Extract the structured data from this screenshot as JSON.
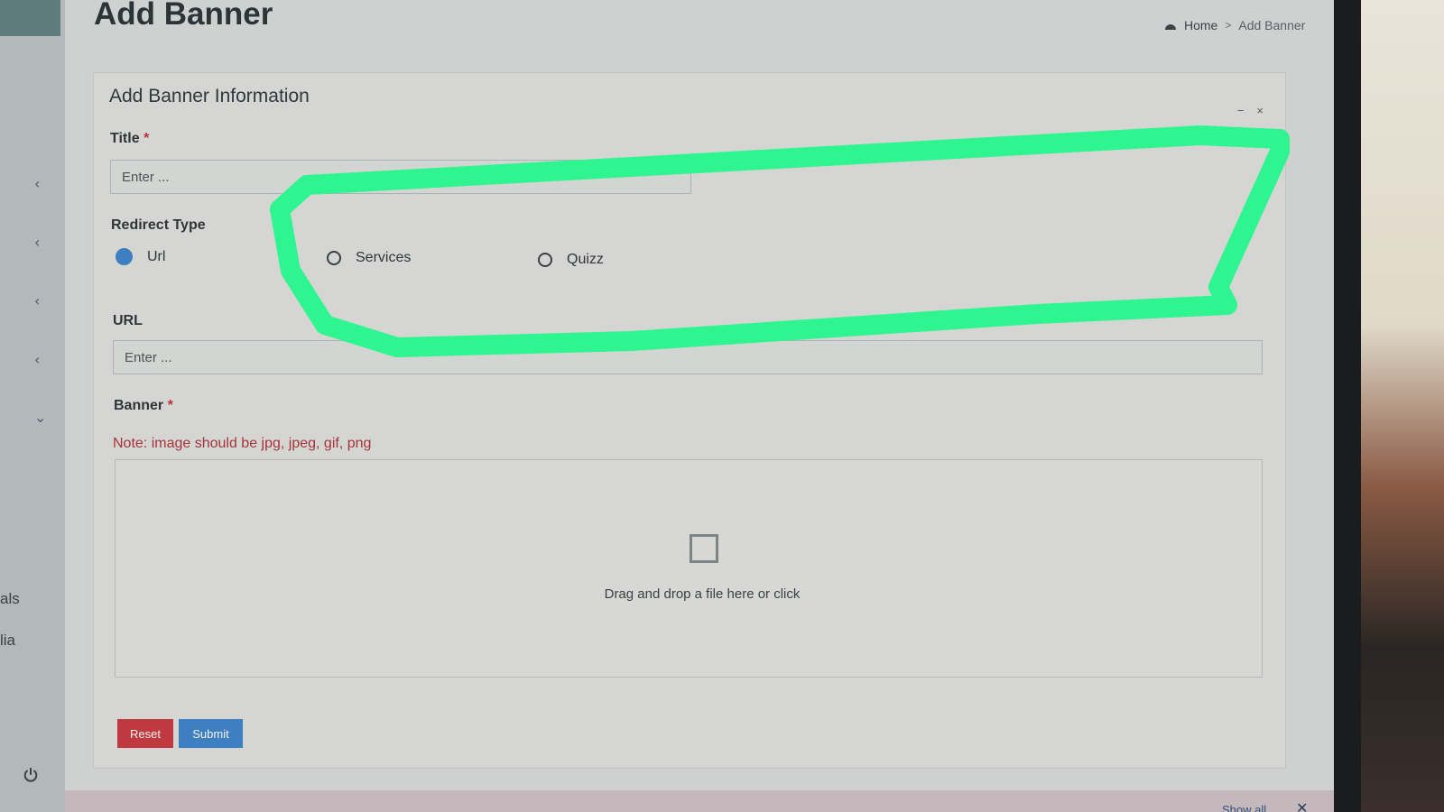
{
  "page": {
    "title": "Add Banner"
  },
  "breadcrumb": {
    "home": "Home",
    "separator": ">",
    "current": "Add Banner"
  },
  "sidebar": {
    "partial_items": [
      "als",
      "lia"
    ]
  },
  "form": {
    "box_title": "Add Banner Information",
    "tools": {
      "minimize": "−",
      "close": "×"
    },
    "title_label": "Title",
    "required_mark": "*",
    "title_placeholder": "Enter ...",
    "redirect_label": "Redirect Type",
    "redirect_options": [
      {
        "label": "Url",
        "selected": true
      },
      {
        "label": "Services",
        "selected": false
      },
      {
        "label": "Quizz",
        "selected": false
      }
    ],
    "url_label": "URL",
    "url_placeholder": "Enter ...",
    "banner_label": "Banner",
    "banner_note": "Note: image should be jpg, jpeg, gif, png",
    "dropzone_text": "Drag and drop a file here or click",
    "reset_label": "Reset",
    "submit_label": "Submit"
  },
  "footer": {
    "show_all": "Show all",
    "close": "✕"
  },
  "colors": {
    "accent": "#3d7fc0",
    "danger": "#c0393f",
    "highlight": "#2ef58f"
  }
}
